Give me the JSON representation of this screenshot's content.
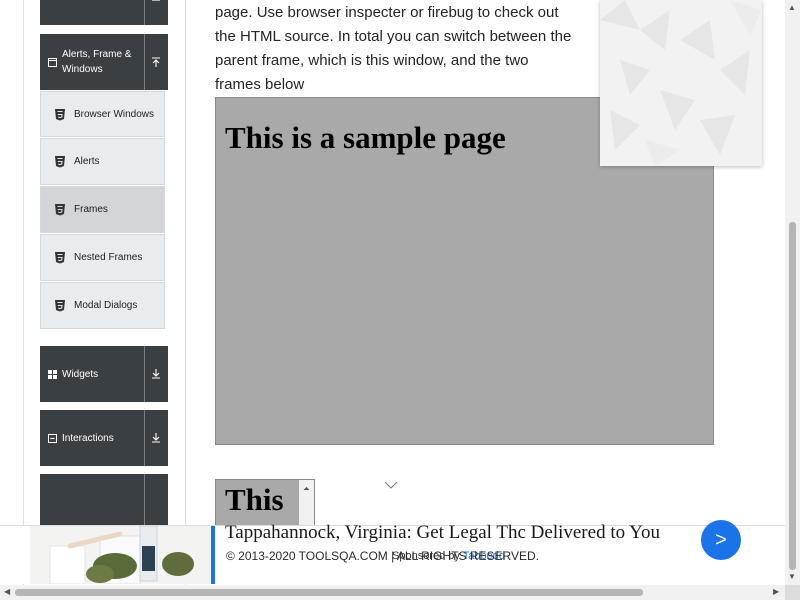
{
  "sidebar": {
    "alerts_group": {
      "label": "Alerts, Frame & Windows"
    },
    "items": [
      {
        "label": "Browser Windows"
      },
      {
        "label": "Alerts"
      },
      {
        "label": "Frames"
      },
      {
        "label": "Nested Frames"
      },
      {
        "label": "Modal Dialogs"
      }
    ],
    "widgets_group": {
      "label": "Widgets"
    },
    "interactions_group": {
      "label": "Interactions"
    }
  },
  "main": {
    "description": "page. Use browser inspecter or firebug to check out the HTML source. In total you can switch between the parent frame, which is this window, and the two frames below",
    "frame1_heading": "This is a sample page",
    "frame2_heading": "This"
  },
  "ad": {
    "title": "Tappahannock, Virginia: Get Legal Thc Delivered to You",
    "sponsored_prefix": "Sponsored by",
    "sponsor": "Tabbedd",
    "arrow": ">"
  },
  "footer": {
    "copyright": "© 2013-2020 TOOLSQA.COM | ALL RIGHTS RESERVED."
  },
  "colors": {
    "group_bg": "#3a3f44",
    "frame_bg": "#a9a9a9",
    "accent": "#1a73e8"
  }
}
